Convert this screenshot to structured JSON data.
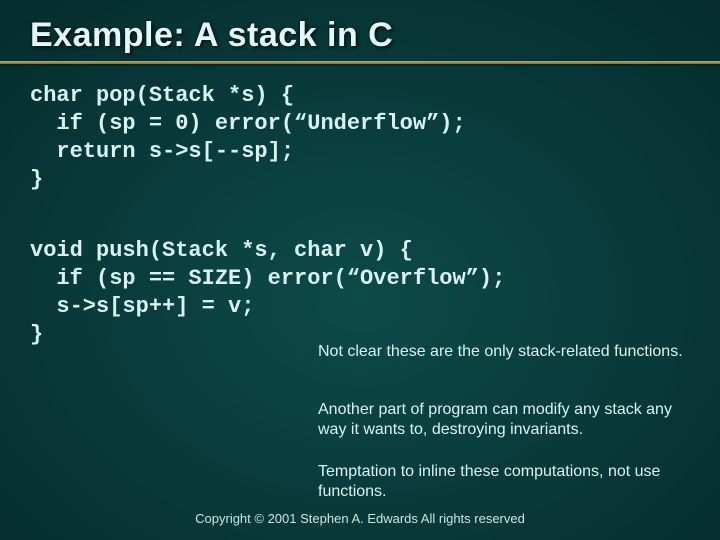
{
  "title": "Example: A stack in C",
  "code1": "char pop(Stack *s) {\n  if (sp = 0) error(“Underflow”);\n  return s->s[--sp];\n}",
  "code2": "void push(Stack *s, char v) {\n  if (sp == SIZE) error(“Overflow”);\n  s->s[sp++] = v;\n}",
  "notes": {
    "n1": "Not clear these are the only stack-related functions.",
    "n2": "Another part of program can modify any stack any way it wants to, destroying invariants.",
    "n3": "Temptation to inline these computations, not use functions."
  },
  "copyright": "Copyright © 2001 Stephen A. Edwards  All rights reserved"
}
